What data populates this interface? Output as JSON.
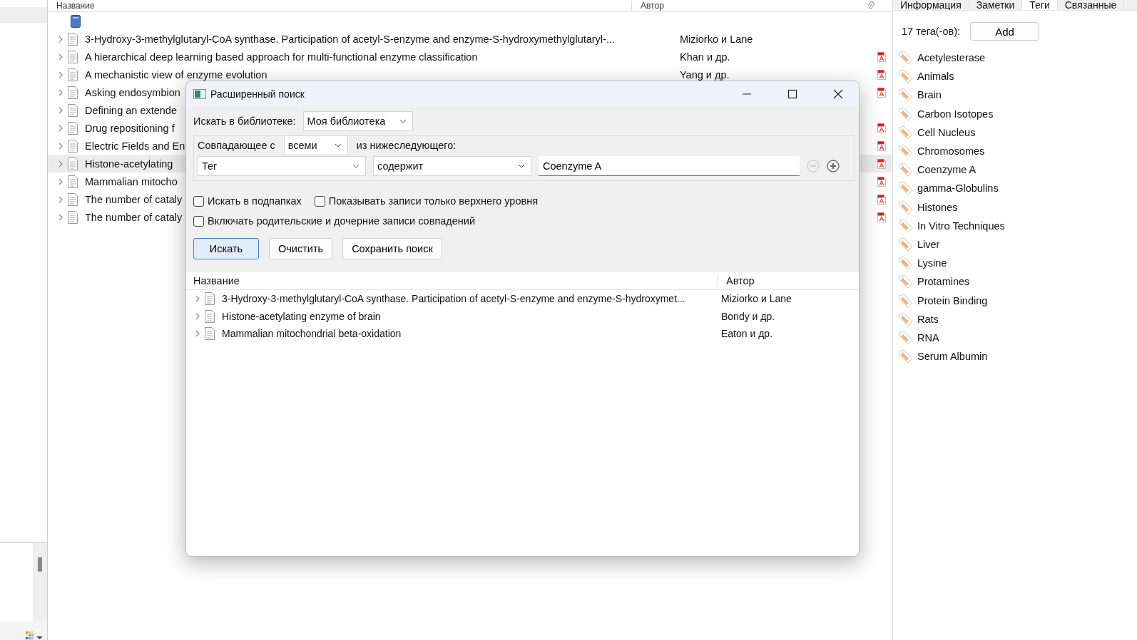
{
  "library_list": {
    "columns": [
      "Название",
      "Автор"
    ],
    "rows": [
      {
        "kind": "library"
      },
      {
        "kind": "item",
        "title": "3-Hydroxy-3-methylglutaryl-CoA synthase. Participation of acetyl-S-enzyme and enzyme-S-hydroxymethylglutaryl-...",
        "author": "Miziorko и Lane",
        "has_pdf": false,
        "selected": false
      },
      {
        "kind": "item",
        "title": "A hierarchical deep learning based approach for multi-functional enzyme classification",
        "author": "Khan и др.",
        "has_pdf": true,
        "selected": false
      },
      {
        "kind": "item",
        "title": "A mechanistic view of enzyme evolution",
        "author": "Yang и др.",
        "has_pdf": true,
        "selected": false
      },
      {
        "kind": "item",
        "title": "Asking endosymbion",
        "has_pdf": true,
        "selected": false
      },
      {
        "kind": "item",
        "title": "Defining an extende",
        "has_pdf": false,
        "selected": false
      },
      {
        "kind": "item",
        "title": "Drug repositioning f",
        "has_pdf": true,
        "selected": false
      },
      {
        "kind": "item",
        "title": "Electric Fields and En",
        "has_pdf": true,
        "selected": false
      },
      {
        "kind": "item",
        "title": "Histone-acetylating",
        "has_pdf": true,
        "selected": true
      },
      {
        "kind": "item",
        "title": "Mammalian mitocho",
        "has_pdf": true,
        "selected": false
      },
      {
        "kind": "item",
        "title": "The number of cataly",
        "has_pdf": true,
        "selected": false
      },
      {
        "kind": "item",
        "title": "The number of cataly",
        "has_pdf": true,
        "selected": false
      }
    ]
  },
  "right_panel": {
    "tabs": [
      {
        "label": "Информация",
        "selected": false
      },
      {
        "label": "Заметки",
        "selected": false
      },
      {
        "label": "Теги",
        "selected": true
      },
      {
        "label": "Связанные",
        "selected": false
      }
    ],
    "tag_count": "17 тега(-ов):",
    "add_button": "Add",
    "tags": [
      "Acetylesterase",
      "Animals",
      "Brain",
      "Carbon Isotopes",
      "Cell Nucleus",
      "Chromosomes",
      "Coenzyme A",
      "gamma-Globulins",
      "Histones",
      "In Vitro Techniques",
      "Liver",
      "Lysine",
      "Protamines",
      "Protein Binding",
      "Rats",
      "RNA",
      "Serum Albumin"
    ]
  },
  "dialog": {
    "title": "Расширенный поиск",
    "library_label": "Искать в библиотеке:",
    "library_value": "Моя библиотека",
    "match_label": "Совпадающее с",
    "match_value": "всеми",
    "match_suffix": "из нижеследующего:",
    "condition": {
      "field": "Тег",
      "operator": "содержит",
      "value": "Coenzyme A",
      "remove_disabled": true
    },
    "checkboxes": [
      {
        "label": "Искать в подпапках",
        "checked": false
      },
      {
        "label": "Показывать записи только верхнего уровня",
        "checked": false
      },
      {
        "label": "Включать родительские и дочерние записи совпадений",
        "checked": false
      }
    ],
    "buttons": [
      {
        "label": "Искать",
        "default": true
      },
      {
        "label": "Очистить",
        "default": false
      },
      {
        "label": "Сохранить поиск",
        "default": false
      }
    ],
    "results": {
      "columns": [
        "Название",
        "Автор"
      ],
      "rows": [
        {
          "title": "3-Hydroxy-3-methylglutaryl-CoA synthase. Participation of acetyl-S-enzyme and enzyme-S-hydroxymet...",
          "author": "Miziorko и Lane"
        },
        {
          "title": "Histone-acetylating enzyme of brain",
          "author": "Bondy и др."
        },
        {
          "title": "Mammalian mitochondrial beta-oxidation",
          "author": "Eaton и др."
        }
      ]
    }
  }
}
